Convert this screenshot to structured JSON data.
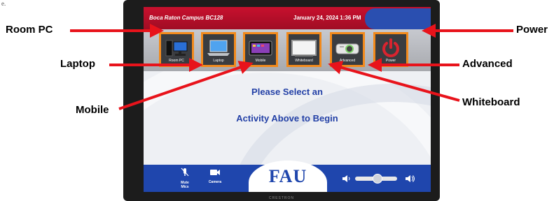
{
  "page": {
    "mark": "e."
  },
  "panel": {
    "campus": "Boca Raton Campus BC128",
    "datetime": "January 24, 2024 1:36 PM",
    "tiles": [
      {
        "label": "Room PC",
        "icon": "desktop-icon"
      },
      {
        "label": "Laptop",
        "icon": "laptop-icon"
      },
      {
        "label": "Mobile",
        "icon": "tablet-icon"
      },
      {
        "label": "Whiteboard",
        "icon": "whiteboard-icon"
      },
      {
        "label": "Advanced",
        "icon": "projector-icon"
      },
      {
        "label": "Power",
        "icon": "power-icon"
      }
    ],
    "prompt_line1": "Please Select an",
    "prompt_line2": "Activity Above to Begin",
    "bottom": {
      "mute_label_1": "Mute",
      "mute_label_2": "Mics",
      "camera_label": "Camera",
      "logo_text": "FAU",
      "volume_level": 0.55
    },
    "brand": "CRESTRON"
  },
  "callouts": {
    "room_pc": "Room PC",
    "laptop": "Laptop",
    "mobile": "Mobile",
    "power": "Power",
    "advanced": "Advanced",
    "whiteboard": "Whiteboard"
  },
  "colors": {
    "header_red": "#c8102e",
    "tile_border": "#f28a1c",
    "fau_blue": "#1f46ad",
    "arrow_red": "#e8131b"
  }
}
